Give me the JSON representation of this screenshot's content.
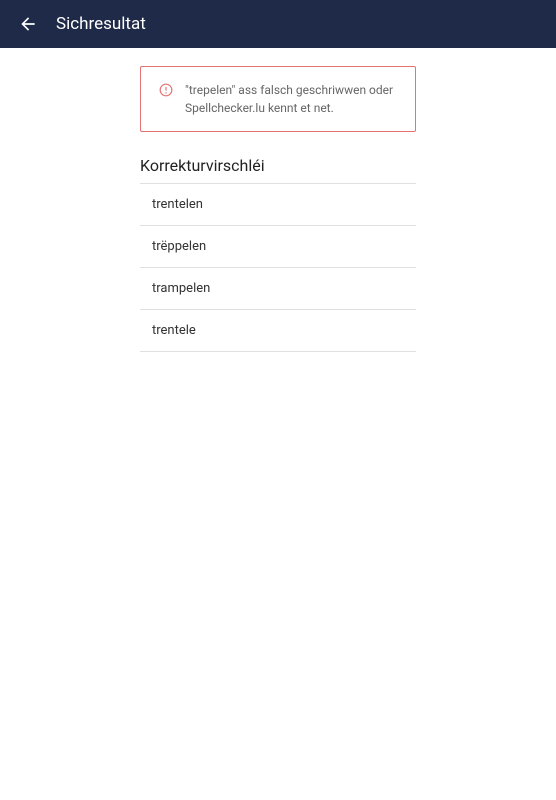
{
  "header": {
    "title": "Sichresultat"
  },
  "alert": {
    "message": "\"trepelen\" ass falsch geschriwwen oder Spellchecker.lu kennt et net."
  },
  "suggestions": {
    "heading": "Korrekturvirschléi",
    "items": [
      "trentelen",
      "trëppelen",
      "trampelen",
      "trentele"
    ]
  }
}
